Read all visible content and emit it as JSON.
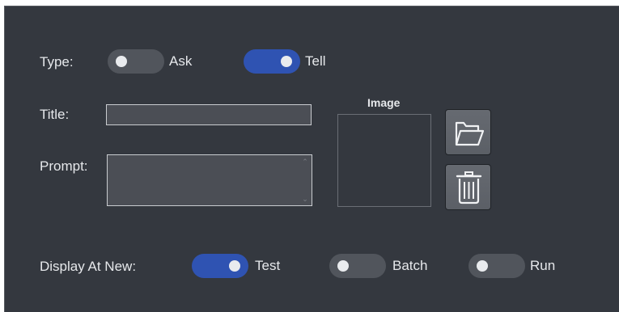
{
  "type_row": {
    "label": "Type:",
    "options": [
      {
        "label": "Ask",
        "checked": false
      },
      {
        "label": "Tell",
        "checked": true
      }
    ]
  },
  "title_field": {
    "label": "Title:",
    "value": ""
  },
  "prompt_field": {
    "label": "Prompt:",
    "value": ""
  },
  "image": {
    "label": "Image",
    "open_icon": "folder-open-icon",
    "delete_icon": "trash-icon"
  },
  "display_row": {
    "label": "Display At New:",
    "options": [
      {
        "label": "Test",
        "checked": true
      },
      {
        "label": "Batch",
        "checked": false
      },
      {
        "label": "Run",
        "checked": false
      }
    ]
  },
  "colors": {
    "panel_bg": "#34383f",
    "toggle_on": "#2f53b2",
    "toggle_off": "#51555c",
    "text": "#e6e8eb"
  }
}
